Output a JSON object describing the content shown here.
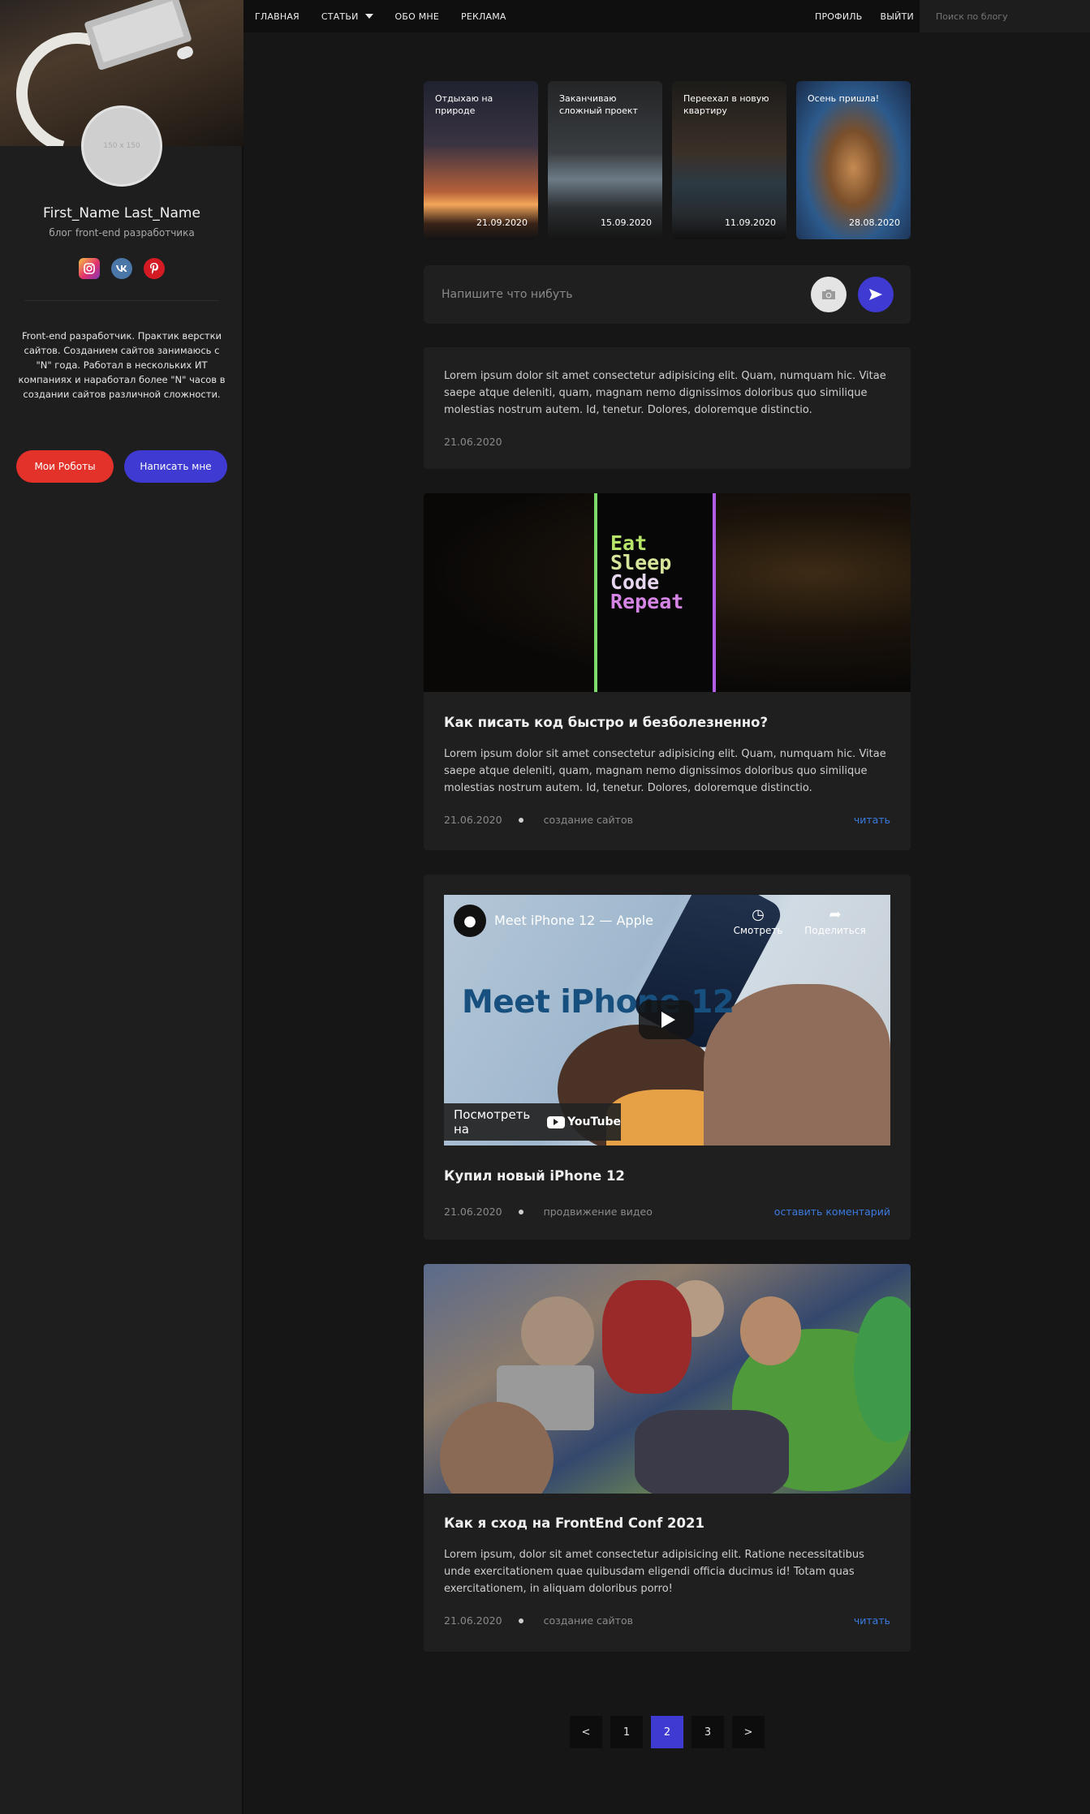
{
  "nav": {
    "items": [
      "ГЛАВНАЯ",
      "СТАТЬИ",
      "ОБО МНЕ",
      "РЕКЛАМА"
    ],
    "profile": "ПРОФИЛЬ",
    "logout": "ВЫЙТИ",
    "search_placeholder": "Поиск по блогу"
  },
  "sidebar": {
    "avatar_placeholder": "150 x 150",
    "name": "First_Name Last_Name",
    "subtitle": "блог front-end разработчика",
    "socials": [
      "instagram-icon",
      "vk-icon",
      "pinterest-icon"
    ],
    "about": "Front-end разработчик. Практик верстки сайтов. Созданием сайтов занимаюсь с \"N\" года. Работал в нескольких ИТ компаниях и наработал более \"N\" часов в создании сайтов различной сложности.",
    "btn_robots": "Мои Роботы",
    "btn_write": "Написать мне"
  },
  "stories": [
    {
      "title": "Отдыхаю на природе",
      "date": "21.09.2020"
    },
    {
      "title": "Заканчиваю сложный проект",
      "date": "15.09.2020"
    },
    {
      "title": "Переехал в новую квартиру",
      "date": "11.09.2020"
    },
    {
      "title": "Осень пришла!",
      "date": "28.08.2020"
    }
  ],
  "composer": {
    "placeholder": "Напишите что нибуть"
  },
  "posts": {
    "text_post": {
      "text": "Lorem ipsum dolor sit amet consectetur adipisicing elit. Quam, numquam hic. Vitae saepe atque deleniti, quam, magnam nemo dignissimos doloribus quo similique molestias nostrum autem. Id, tenetur. Dolores, doloremque distinctio.",
      "date": "21.06.2020"
    },
    "code_post": {
      "image_text": [
        "Eat",
        "Sleep",
        "Code",
        "Repeat"
      ],
      "title": "Как писать код быстро и безболезненно?",
      "text": "Lorem ipsum dolor sit amet consectetur adipisicing elit. Quam, numquam hic. Vitae saepe atque deleniti, quam, magnam nemo dignissimos doloribus quo similique molestias nostrum autem. Id, tenetur. Dolores, doloremque distinctio.",
      "date": "21.06.2020",
      "category": "создание сайтов",
      "link": "читать"
    },
    "video_post": {
      "video_title": "Meet iPhone 12 — Apple",
      "video_watch": "Смотреть",
      "video_share": "Поделиться",
      "video_headline": "Meet iPhone 12",
      "video_watch_on": "Посмотреть на",
      "video_brand": "YouTube",
      "title": "Купил новый iPhone 12",
      "date": "21.06.2020",
      "category": "продвижение видео",
      "link": "оставить коментарий"
    },
    "conf_post": {
      "title": "Как я сход на FrontEnd Conf 2021",
      "text": "Lorem ipsum, dolor sit amet consectetur adipisicing elit. Ratione necessitatibus unde exercitationem quae quibusdam eligendi officia ducimus id! Totam quas exercitationem, in aliquam doloribus porro!",
      "date": "21.06.2020",
      "category": "создание сайтов",
      "link": "читать"
    }
  },
  "pagination": {
    "prev": "<",
    "pages": [
      "1",
      "2",
      "3"
    ],
    "current": "2",
    "next": ">"
  },
  "colors": {
    "accent": "#3f3ad1",
    "red": "#e3322a",
    "link": "#3b7be0"
  }
}
